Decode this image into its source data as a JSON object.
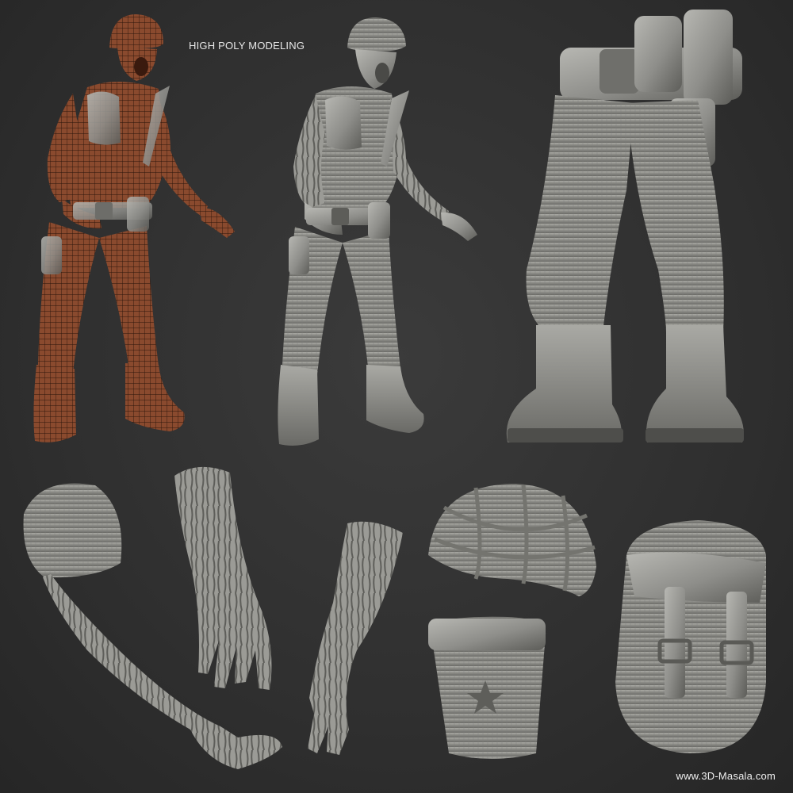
{
  "header": {
    "title": "HIGH POLY MODELING"
  },
  "footer": {
    "watermark": "www.3D-Masala.com"
  },
  "colors": {
    "background": "#2f2f2f",
    "wireframe_skin": "#8a4a2e",
    "wire_lines": "#2a140b",
    "clay": "#8e8e8a",
    "clay_shadow": "#5e5e5a",
    "clay_highlight": "#b9b9b4"
  },
  "panels": [
    {
      "name": "wireframe-zombie-soldier",
      "kind": "figure"
    },
    {
      "name": "sculpt-zombie-soldier",
      "kind": "figure"
    },
    {
      "name": "legs-and-boots-detail",
      "kind": "detail"
    },
    {
      "name": "arm-with-sleeve-detail",
      "kind": "detail"
    },
    {
      "name": "hand-detail",
      "kind": "detail"
    },
    {
      "name": "forearm-detail",
      "kind": "detail"
    },
    {
      "name": "helmet-with-net-detail",
      "kind": "detail"
    },
    {
      "name": "pouch-with-star-detail",
      "kind": "detail"
    },
    {
      "name": "backpack-detail",
      "kind": "detail"
    }
  ]
}
